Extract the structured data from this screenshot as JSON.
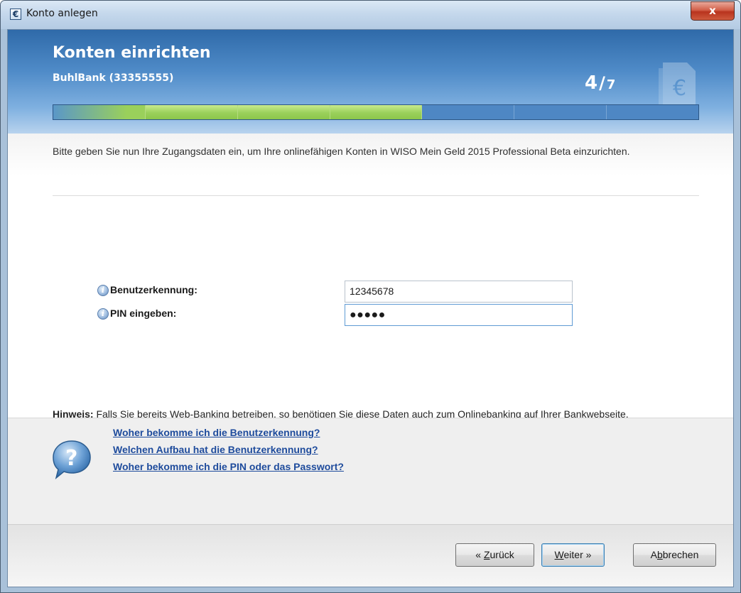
{
  "window": {
    "title": "Konto anlegen",
    "close_label": "x",
    "app_icon": "euro-icon"
  },
  "banner": {
    "title": "Konten einrichten",
    "subtitle": "BuhlBank (33355555)",
    "step_current": "4",
    "step_separator": "/",
    "step_total": "7",
    "progress": {
      "segments_total": 7,
      "segments_done": 4
    },
    "watermark_icon": "euro-document-icon"
  },
  "intro": {
    "text": "Bitte geben Sie nun Ihre Zugangsdaten ein, um Ihre onlinefähigen Konten in  WISO Mein Geld 2015 Professional Beta einzurichten."
  },
  "form": {
    "user_id": {
      "label": "Benutzerkennung:",
      "value": "12345678",
      "icon": "info-icon"
    },
    "pin": {
      "label": "PIN eingeben:",
      "value_masked": "●●●●●",
      "icon": "info-icon"
    }
  },
  "hint": {
    "label": "Hinweis:",
    "text": " Falls Sie bereits Web-Banking betreiben, so benötigen Sie diese Daten auch zum Onlinebanking auf Ihrer Bankwebseite."
  },
  "help": {
    "icon": "question-bubble-icon",
    "links": [
      "Woher bekomme ich die Benutzerkennung?",
      "Welchen Aufbau hat die Benutzerkennung?",
      "Woher bekomme ich die PIN oder das Passwort?"
    ]
  },
  "buttons": {
    "back": {
      "prefix": "« ",
      "key": "Z",
      "rest": "urück"
    },
    "next": {
      "key": "W",
      "rest": "eiter",
      "suffix": " »"
    },
    "cancel": {
      "pre": "A",
      "key": "b",
      "rest": "brechen"
    }
  },
  "colors": {
    "banner_top": "#2f6aa9",
    "progress_done": "#9ad05b",
    "progress_todo": "#4e87c4",
    "link": "#1e4b9c",
    "close_button": "#c8452b"
  }
}
